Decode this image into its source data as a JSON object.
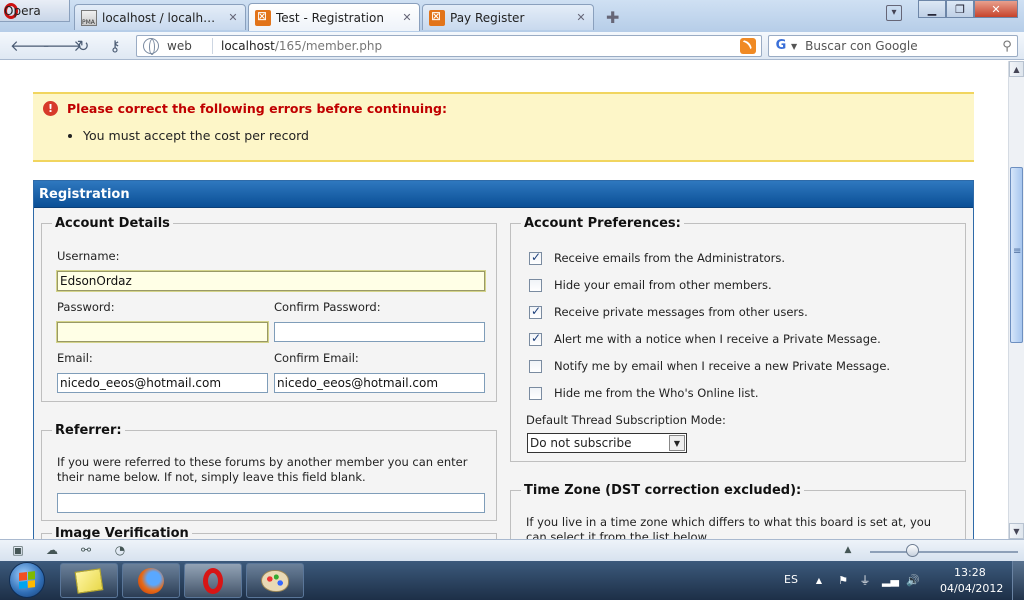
{
  "browser": {
    "menu_label": "Opera",
    "tabs": [
      {
        "title": "localhost / localhost / ..."
      },
      {
        "title": "Test - Registration"
      },
      {
        "title": "Pay Register"
      }
    ],
    "address": {
      "scheme_label": "web",
      "host": "localhost",
      "path": "/165/member.php"
    },
    "search": {
      "placeholder": "Buscar con Google"
    }
  },
  "page": {
    "error": {
      "title": "Please correct the following errors before continuing:",
      "items": [
        "You must accept the cost per record"
      ]
    },
    "registration": {
      "header": "Registration",
      "account_details": {
        "legend": "Account Details",
        "username_label": "Username:",
        "username_value": "EdsonOrdaz",
        "password_label": "Password:",
        "confirm_password_label": "Confirm Password:",
        "email_label": "Email:",
        "email_value": "nicedo_eeos@hotmail.com",
        "confirm_email_label": "Confirm Email:",
        "confirm_email_value": "nicedo_eeos@hotmail.com"
      },
      "referrer": {
        "legend": "Referrer:",
        "help_line1": "If you were referred to these forums by another member you can enter",
        "help_line2": "their name below. If not, simply leave this field blank."
      },
      "image_verification": {
        "legend": "Image Verification"
      },
      "account_preferences": {
        "legend": "Account Preferences:",
        "options": [
          {
            "label": "Receive emails from the Administrators.",
            "checked": true
          },
          {
            "label": "Hide your email from other members.",
            "checked": false
          },
          {
            "label": "Receive private messages from other users.",
            "checked": true
          },
          {
            "label": "Alert me with a notice when I receive a Private Message.",
            "checked": true
          },
          {
            "label": "Notify me by email when I receive a new Private Message.",
            "checked": false
          },
          {
            "label": "Hide me from the Who's Online list.",
            "checked": false
          }
        ],
        "subscription_label": "Default Thread Subscription Mode:",
        "subscription_value": "Do not subscribe"
      },
      "time_zone": {
        "legend": "Time Zone (DST correction excluded):",
        "help_line1": "If you live in a time zone which differs to what this board is set at, you",
        "help_line2": "can select it from the list below."
      }
    }
  },
  "taskbar": {
    "language": "ES",
    "time": "13:28",
    "date": "04/04/2012"
  }
}
